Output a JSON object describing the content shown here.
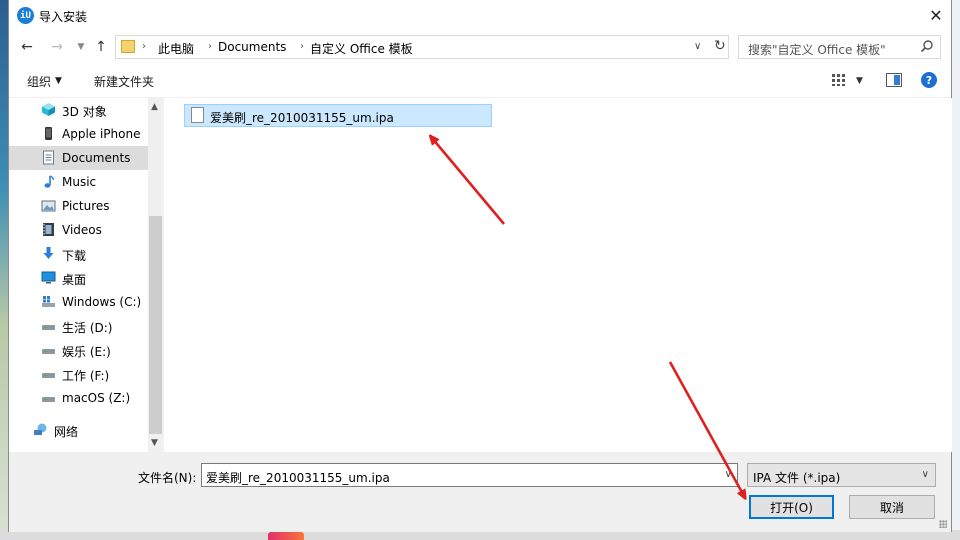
{
  "window": {
    "title": "导入安装",
    "app_icon_text": "iU",
    "close_label": "✕"
  },
  "address": {
    "crumbs": [
      "此电脑",
      "Documents",
      "自定义 Office 模板"
    ],
    "search_placeholder": "搜索\"自定义 Office 模板\""
  },
  "toolbar": {
    "organize_label": "组织",
    "new_folder_label": "新建文件夹",
    "help_label": "?"
  },
  "sidebar": {
    "items": [
      {
        "label": "3D 对象",
        "icon": "3d-objects-icon"
      },
      {
        "label": "Apple iPhone",
        "icon": "iphone-icon"
      },
      {
        "label": "Documents",
        "icon": "documents-icon",
        "selected": true
      },
      {
        "label": "Music",
        "icon": "music-icon"
      },
      {
        "label": "Pictures",
        "icon": "pictures-icon"
      },
      {
        "label": "Videos",
        "icon": "videos-icon"
      },
      {
        "label": "下载",
        "icon": "download-icon"
      },
      {
        "label": "桌面",
        "icon": "desktop-icon"
      },
      {
        "label": "Windows (C:)",
        "icon": "windows-drive-icon"
      },
      {
        "label": "生活 (D:)",
        "icon": "drive-icon"
      },
      {
        "label": "娱乐 (E:)",
        "icon": "drive-icon"
      },
      {
        "label": "工作 (F:)",
        "icon": "drive-icon"
      },
      {
        "label": "macOS (Z:)",
        "icon": "drive-icon"
      },
      {
        "label": "网络",
        "icon": "network-icon"
      }
    ]
  },
  "files": [
    {
      "name": "爱美刷_re_2010031155_um.ipa",
      "selected": true
    }
  ],
  "footer": {
    "filename_label": "文件名(N):",
    "filename_value": "爱美刷_re_2010031155_um.ipa",
    "filetype_value": "IPA 文件 (*.ipa)",
    "open_label": "打开(O)",
    "cancel_label": "取消"
  },
  "colors": {
    "selection": "#cce8ff",
    "accent": "#0078d7",
    "annotation_arrow": "#e02020"
  }
}
